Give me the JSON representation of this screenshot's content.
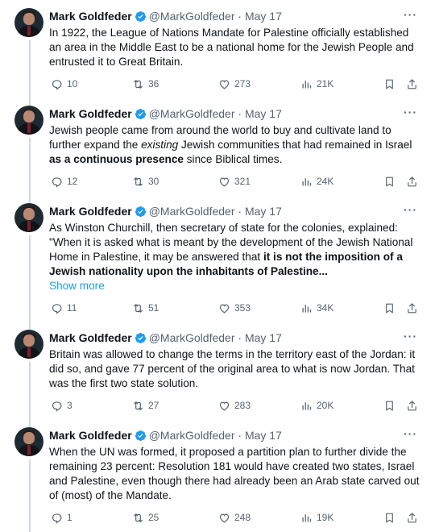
{
  "tweets": [
    {
      "author": "Mark Goldfeder",
      "handle": "@MarkGoldfeder",
      "date": "May 17",
      "text": "In 1922, the League of Nations Mandate for Palestine officially established an area in the Middle East to be a national home for the Jewish People and entrusted it to Great Britain.",
      "show_more": "",
      "replies": "10",
      "retweets": "36",
      "likes": "273",
      "views": "21K"
    },
    {
      "author": "Mark Goldfeder",
      "handle": "@MarkGoldfeder",
      "date": "May 17",
      "text_parts": [
        "Jewish people came from around the world to buy and cultivate land to further expand the ",
        "existing",
        " Jewish communities that had remained in Israel ",
        "as a continuous presence",
        " since Biblical times."
      ],
      "show_more": "",
      "replies": "12",
      "retweets": "30",
      "likes": "321",
      "views": "24K"
    },
    {
      "author": "Mark Goldfeder",
      "handle": "@MarkGoldfeder",
      "date": "May 17",
      "text_parts": [
        "As Winston Churchill, then secretary of state for the colonies, explained: \"When it is asked what is meant by the development of the Jewish National Home in Palestine, it may be answered that ",
        "it is not the imposition of a Jewish nationality upon the inhabitants of Palestine..."
      ],
      "show_more": "Show more",
      "replies": "11",
      "retweets": "51",
      "likes": "353",
      "views": "34K"
    },
    {
      "author": "Mark Goldfeder",
      "handle": "@MarkGoldfeder",
      "date": "May 17",
      "text": "Britain was allowed to change the terms in the territory east of the Jordan: it did so, and gave 77 percent of the original area to what is now Jordan. That was the first two state solution.",
      "show_more": "",
      "replies": "3",
      "retweets": "27",
      "likes": "283",
      "views": "20K"
    },
    {
      "author": "Mark Goldfeder",
      "handle": "@MarkGoldfeder",
      "date": "May 17",
      "text": "When the UN was formed, it proposed a partition plan to further divide the remaining 23 percent: Resolution 181 would have created two states, Israel and Palestine, even though there had already been an Arab state carved out of (most) of the Mandate.",
      "show_more": "",
      "replies": "1",
      "retweets": "25",
      "likes": "248",
      "views": "19K"
    }
  ],
  "separator": "·",
  "more_glyph": "···",
  "colors": {
    "verified": "#1d9bf0",
    "link": "#1d9bf0",
    "muted": "#536471",
    "thread": "#cfd9de"
  },
  "icons": [
    "verified-badge-icon",
    "more-icon",
    "reply-icon",
    "retweet-icon",
    "like-icon",
    "views-icon",
    "bookmark-icon",
    "share-icon"
  ]
}
